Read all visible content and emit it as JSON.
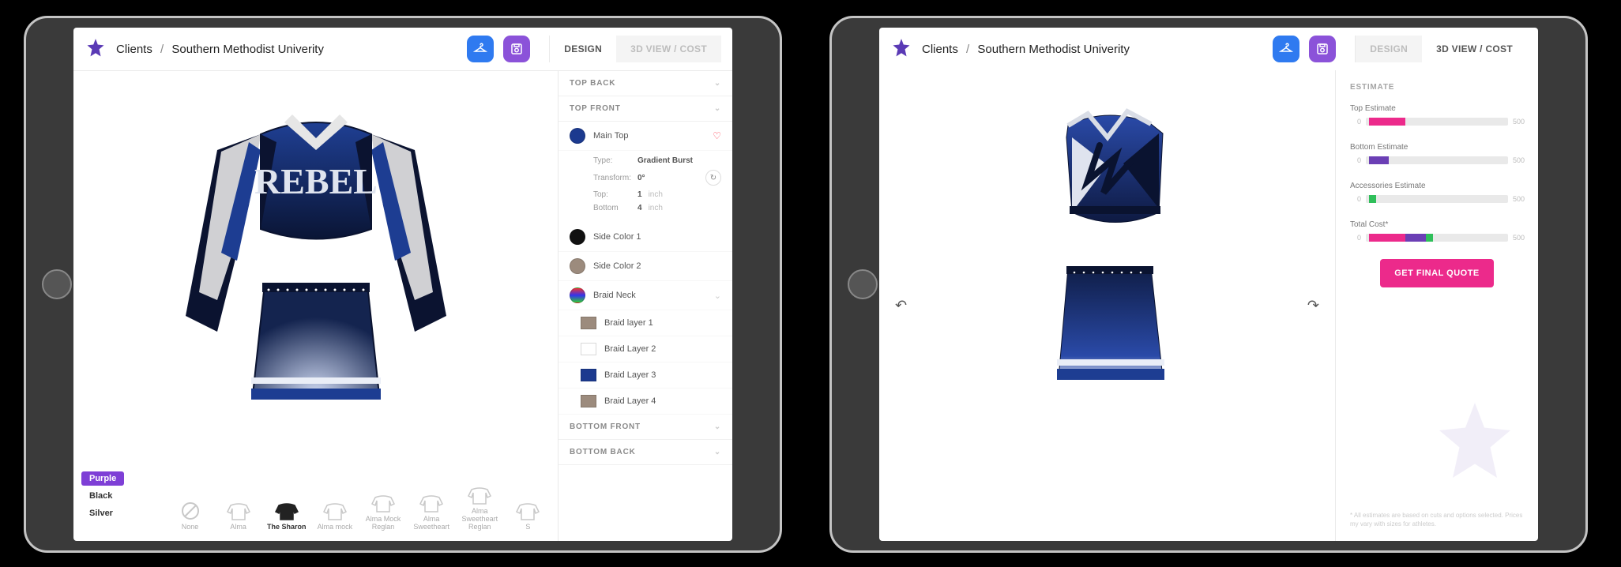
{
  "breadcrumb": {
    "root": "Clients",
    "current": "Southern Methodist Univerity"
  },
  "tabs": {
    "design": "DESIGN",
    "cost": "3D VIEW / COST"
  },
  "colors": [
    "Purple",
    "Black",
    "Silver"
  ],
  "thumbs": [
    {
      "label": "None"
    },
    {
      "label": "Alma"
    },
    {
      "label": "The Sharon",
      "selected": true,
      "dark": true
    },
    {
      "label": "Alma mock"
    },
    {
      "label": "Alma Mock Reglan"
    },
    {
      "label": "Alma Sweetheart"
    },
    {
      "label": "Alma Sweetheart Reglan"
    },
    {
      "label": "S"
    }
  ],
  "sections": {
    "topBack": "TOP BACK",
    "topFront": "TOP FRONT",
    "bottomFront": "BOTTOM FRONT",
    "bottomBack": "BOTTOM BACK"
  },
  "layers": {
    "main": "Main Top",
    "side1": "Side Color 1",
    "side2": "Side Color 2",
    "braid": "Braid Neck",
    "b1": "Braid layer 1",
    "b2": "Braid Layer 2",
    "b3": "Braid Layer 3",
    "b4": "Braid Layer 4"
  },
  "mainDetail": {
    "typeK": "Type:",
    "typeV": "Gradient Burst",
    "transK": "Transform:",
    "transV": "0°",
    "topK": "Top:",
    "topV": "1",
    "topU": "inch",
    "botK": "Bottom",
    "botV": "4",
    "botU": "inch"
  },
  "cost": {
    "heading": "ESTIMATE",
    "top": "Top Estimate",
    "bottom": "Bottom Estimate",
    "acc": "Accessories Estimate",
    "total": "Total Cost*",
    "min": "0",
    "max": "500",
    "cta": "GET FINAL QUOTE",
    "disclaimer": "* All estimates are based on cuts and options selected. Prices my vary with sizes for athletes."
  },
  "garmentText": "REBEL"
}
